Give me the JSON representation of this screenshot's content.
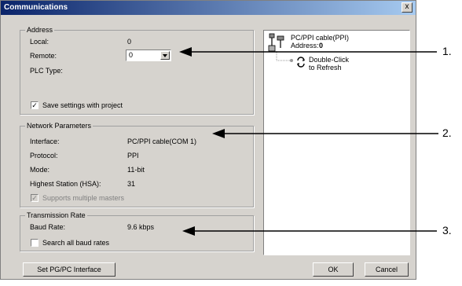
{
  "dialog": {
    "title": "Communications",
    "close_label": "x"
  },
  "address": {
    "legend": "Address",
    "local_label": "Local:",
    "local_value": "0",
    "remote_label": "Remote:",
    "remote_value": "0",
    "plc_type_label": "PLC Type:",
    "save_settings_label": "Save settings with project",
    "save_settings_checked": true
  },
  "network": {
    "legend": "Network Parameters",
    "interface_label": "Interface:",
    "interface_value": "PC/PPI cable(COM 1)",
    "protocol_label": "Protocol:",
    "protocol_value": "PPI",
    "mode_label": "Mode:",
    "mode_value": "11-bit",
    "hsa_label": "Highest Station (HSA):",
    "hsa_value": "31",
    "multi_master_label": "Supports multiple masters",
    "multi_master_checked": true
  },
  "transmission": {
    "legend": "Transmission Rate",
    "baud_label": "Baud Rate:",
    "baud_value": "9.6 kbps",
    "search_label": "Search all baud rates",
    "search_checked": false
  },
  "tree": {
    "cable_name": "PC/PPI cable(PPI)",
    "address_label": "Address:",
    "address_value": "0",
    "refresh_line1": "Double-Click",
    "refresh_line2": "to Refresh"
  },
  "buttons": {
    "set_interface": "Set PG/PC Interface",
    "ok": "OK",
    "cancel": "Cancel"
  },
  "callouts": [
    "1.",
    "2.",
    "3."
  ]
}
